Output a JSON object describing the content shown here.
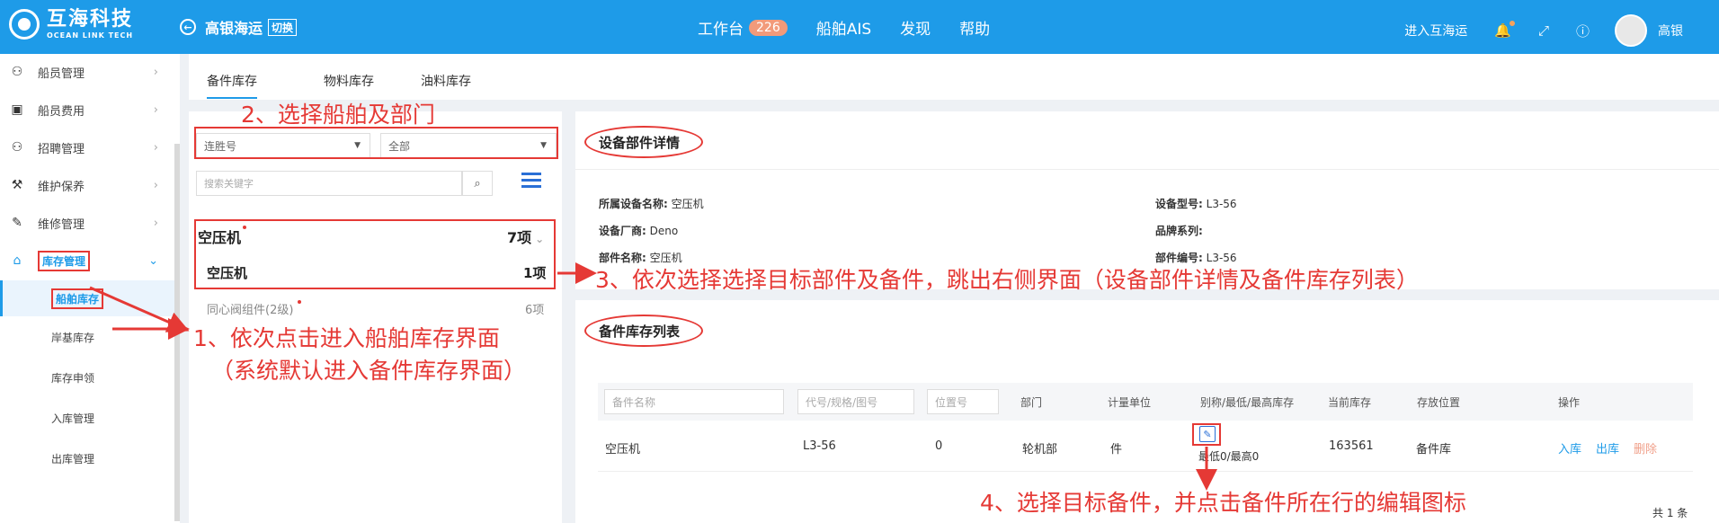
{
  "header": {
    "logo_cn": "互海科技",
    "logo_en": "OCEAN LINK TECH",
    "company": "高银海运",
    "switch_label": "切换",
    "nav": [
      {
        "label": "工作台",
        "badge": "226"
      },
      {
        "label": "船舶AIS"
      },
      {
        "label": "发现"
      },
      {
        "label": "帮助"
      }
    ],
    "enter_link": "进入互海运",
    "user_name": "高银"
  },
  "sidebar": {
    "items": [
      "船员管理",
      "船员费用",
      "招聘管理",
      "维护保养",
      "维修管理",
      "库存管理"
    ],
    "sub_items": [
      "船舶库存",
      "岸基库存",
      "库存申领",
      "入库管理",
      "出库管理"
    ]
  },
  "tabs": [
    "备件库存",
    "物料库存",
    "油料库存"
  ],
  "left_panel": {
    "ship_select": "连胜号",
    "dept_select": "全部",
    "search_placeholder": "搜索关键字",
    "group1": {
      "name": "空压机",
      "count": "7项"
    },
    "group1_sub": {
      "name": "空压机",
      "count": "1项"
    },
    "group2": {
      "name": "同心阀组件(2级)",
      "count": "6项"
    }
  },
  "detail": {
    "title": "设备部件详情",
    "fields": [
      {
        "label": "所属设备名称:",
        "value": "空压机"
      },
      {
        "label": "设备型号:",
        "value": "L3-56"
      },
      {
        "label": "设备厂商:",
        "value": "Deno"
      },
      {
        "label": "品牌系列:",
        "value": ""
      },
      {
        "label": "部件名称:",
        "value": "空压机"
      },
      {
        "label": "部件编号:",
        "value": "L3-56"
      }
    ]
  },
  "stock_list": {
    "title": "备件库存列表",
    "filter_placeholders": [
      "备件名称",
      "代号/规格/图号",
      "位置号"
    ],
    "headers": [
      "部门",
      "计量单位",
      "别称/最低/最高库存",
      "当前库存",
      "存放位置",
      "操作"
    ],
    "row": {
      "name": "空压机",
      "code": "L3-56",
      "position": "0",
      "department": "轮机部",
      "unit": "件",
      "min_max": "最低0/最高0",
      "current": "163561",
      "location": "备件库",
      "ops": [
        "入库",
        "出库",
        "删除"
      ]
    },
    "total": "共 1 条"
  },
  "annotations": {
    "step1_line1": "1、依次点击进入船舶库存界面",
    "step1_line2": "（系统默认进入备件库存界面）",
    "step2": "2、选择船舶及部门",
    "step3": "3、依次选择选择目标部件及备件，跳出右侧界面（设备部件详情及备件库存列表）",
    "step4": "4、选择目标备件，并点击备件所在行的编辑图标"
  },
  "colors": {
    "primary": "#1e9be8",
    "annotation": "#e53935",
    "badge": "#f29a7a"
  }
}
